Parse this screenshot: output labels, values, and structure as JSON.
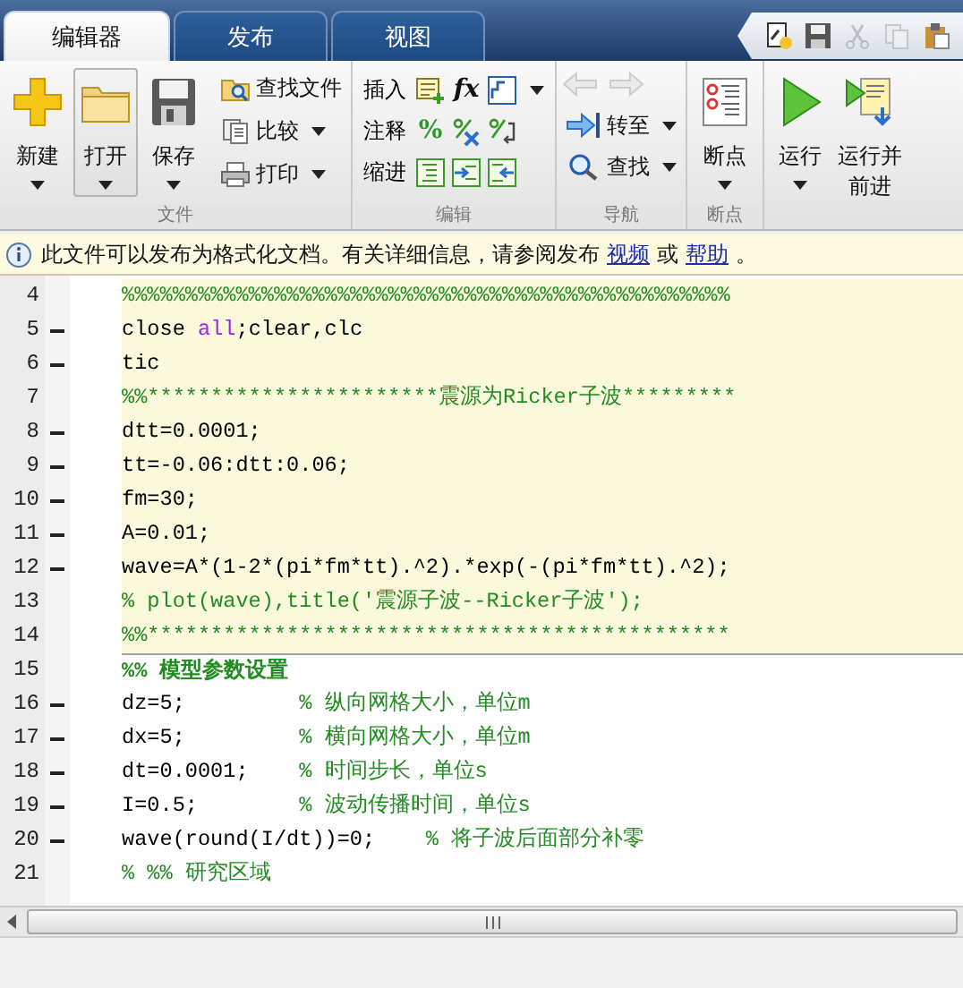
{
  "tabs": [
    {
      "label": "编辑器",
      "selected": true
    },
    {
      "label": "发布",
      "selected": false
    },
    {
      "label": "视图",
      "selected": false
    }
  ],
  "quick_access": [
    {
      "kind": "new",
      "disabled": false
    },
    {
      "kind": "save",
      "disabled": false
    },
    {
      "kind": "cut",
      "disabled": true
    },
    {
      "kind": "copy",
      "disabled": true
    },
    {
      "kind": "paste",
      "disabled": false
    }
  ],
  "ribbon": {
    "file": {
      "title": "文件",
      "big_buttons": [
        {
          "kind": "new",
          "label": "新建",
          "menu": true,
          "pressed": false
        },
        {
          "kind": "open",
          "label": "打开",
          "menu": true,
          "pressed": true
        },
        {
          "kind": "save",
          "label": "保存",
          "menu": true,
          "pressed": false
        }
      ],
      "small_buttons": [
        {
          "kind": "find-file",
          "label": "查找文件",
          "menu": false
        },
        {
          "kind": "compare",
          "label": "比较",
          "menu": true
        },
        {
          "kind": "print",
          "label": "打印",
          "menu": true
        }
      ]
    },
    "edit": {
      "title": "编辑",
      "rows": [
        {
          "label": "插入",
          "menu": true,
          "tools": [
            {
              "kind": "insert"
            },
            {
              "kind": "glyph",
              "text": "fx"
            },
            {
              "kind": "fi"
            }
          ]
        },
        {
          "label": "注释",
          "tools": [
            {
              "kind": "glyph",
              "text": "%"
            },
            {
              "kind": "uncomment"
            },
            {
              "kind": "wrap"
            }
          ]
        },
        {
          "label": "缩进",
          "tools": [
            {
              "kind": "smart-indent"
            },
            {
              "kind": "indent"
            },
            {
              "kind": "outdent"
            }
          ]
        }
      ]
    },
    "navigate": {
      "title": "导航",
      "history": [
        {
          "kind": "back",
          "disabled": true
        },
        {
          "kind": "forward",
          "disabled": true
        }
      ],
      "buttons": [
        {
          "kind": "goto",
          "label": "转至",
          "menu": true
        },
        {
          "kind": "find",
          "label": "查找",
          "menu": true
        }
      ]
    },
    "breakpoints": {
      "title": "断点",
      "button": {
        "label": "断点",
        "menu": true
      }
    },
    "run": {
      "buttons": [
        {
          "kind": "run",
          "lines": [
            "运行"
          ],
          "menu": true
        },
        {
          "kind": "advance",
          "lines": [
            "运行并",
            "前进"
          ],
          "menu": false
        }
      ]
    }
  },
  "info_bar": {
    "segments": [
      {
        "kind": "text",
        "text": "此文件可以发布为格式化文档。有关详细信息，请参阅发布"
      },
      {
        "kind": "link",
        "text": "视频"
      },
      {
        "kind": "text",
        "text": "或"
      },
      {
        "kind": "link",
        "text": "帮助"
      },
      {
        "kind": "text",
        "text": "。"
      }
    ]
  },
  "lines": [
    {
      "number": "4",
      "executable": false,
      "highlighted": true,
      "segments": [
        {
          "kind": "comment",
          "text": "%%%%%%%%%%%%%%%%%%%%%%%%%%%%%%%%%%%%%%%%%%%%%%%%"
        }
      ]
    },
    {
      "number": "5",
      "executable": true,
      "highlighted": true,
      "segments": [
        {
          "kind": "code",
          "text": "close "
        },
        {
          "kind": "keyword",
          "text": "all"
        },
        {
          "kind": "code",
          "text": ";clear,clc"
        }
      ]
    },
    {
      "number": "6",
      "executable": true,
      "highlighted": true,
      "segments": [
        {
          "kind": "code",
          "text": "tic"
        }
      ]
    },
    {
      "number": "7",
      "executable": false,
      "highlighted": true,
      "segments": [
        {
          "kind": "comment",
          "text": "%%***********************震源为Ricker子波*********"
        }
      ]
    },
    {
      "number": "8",
      "executable": true,
      "highlighted": true,
      "segments": [
        {
          "kind": "code",
          "text": "dtt=0.0001;"
        }
      ]
    },
    {
      "number": "9",
      "executable": true,
      "highlighted": true,
      "segments": [
        {
          "kind": "code",
          "text": "tt=-0.06:dtt:0.06;"
        }
      ]
    },
    {
      "number": "10",
      "executable": true,
      "highlighted": true,
      "segments": [
        {
          "kind": "code",
          "text": "fm=30;"
        }
      ]
    },
    {
      "number": "11",
      "executable": true,
      "highlighted": true,
      "segments": [
        {
          "kind": "code",
          "text": "A=0.01;"
        }
      ]
    },
    {
      "number": "12",
      "executable": true,
      "highlighted": true,
      "segments": [
        {
          "kind": "code",
          "text": "wave=A*(1-2*(pi*fm*tt).^2).*exp(-(pi*fm*tt).^2);"
        }
      ]
    },
    {
      "number": "13",
      "executable": false,
      "highlighted": true,
      "segments": [
        {
          "kind": "comment",
          "text": "% plot(wave),title('震源子波--Ricker子波');"
        }
      ]
    },
    {
      "number": "14",
      "executable": false,
      "highlighted": true,
      "segments": [
        {
          "kind": "comment",
          "text": "%%**********************************************"
        }
      ]
    },
    {
      "number": "15",
      "executable": false,
      "highlighted": false,
      "segments": [
        {
          "kind": "cell-title",
          "text": "%% 模型参数设置"
        }
      ]
    },
    {
      "number": "16",
      "executable": true,
      "highlighted": false,
      "segments": [
        {
          "kind": "code",
          "text": "dz=5;         "
        },
        {
          "kind": "comment",
          "text": "% 纵向网格大小，单位m"
        }
      ]
    },
    {
      "number": "17",
      "executable": true,
      "highlighted": false,
      "segments": [
        {
          "kind": "code",
          "text": "dx=5;         "
        },
        {
          "kind": "comment",
          "text": "% 横向网格大小，单位m"
        }
      ]
    },
    {
      "number": "18",
      "executable": true,
      "highlighted": false,
      "segments": [
        {
          "kind": "code",
          "text": "dt=0.0001;    "
        },
        {
          "kind": "comment",
          "text": "% 时间步长，单位s"
        }
      ]
    },
    {
      "number": "19",
      "executable": true,
      "highlighted": false,
      "segments": [
        {
          "kind": "code",
          "text": "I=0.5;        "
        },
        {
          "kind": "comment",
          "text": "% 波动传播时间，单位s"
        }
      ]
    },
    {
      "number": "20",
      "executable": true,
      "highlighted": false,
      "segments": [
        {
          "kind": "code",
          "text": "wave(round(I/dt))=0;    "
        },
        {
          "kind": "comment",
          "text": "% 将子波后面部分补零"
        }
      ]
    },
    {
      "number": "21",
      "executable": false,
      "highlighted": false,
      "segments": [
        {
          "kind": "comment",
          "text": "% %% 研究区域"
        }
      ]
    }
  ]
}
